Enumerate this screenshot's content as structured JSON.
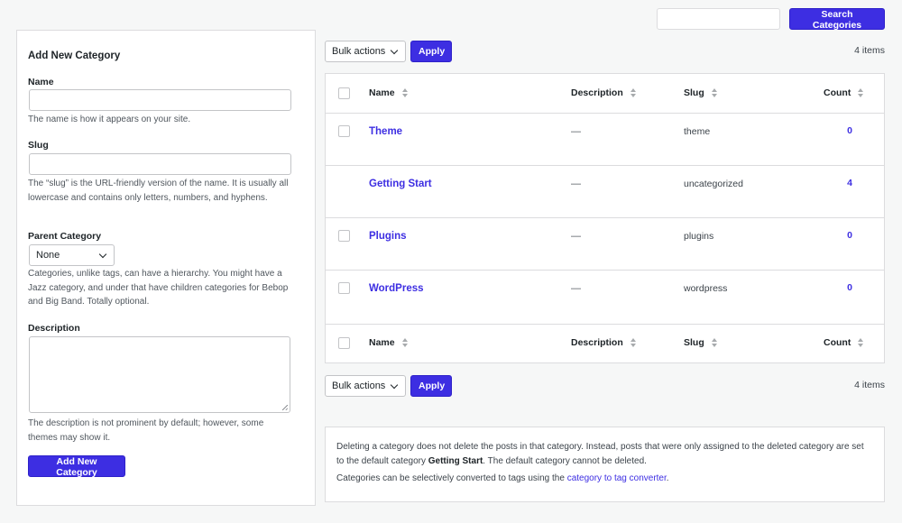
{
  "search": {
    "placeholder": "",
    "button_label": "Search Categories"
  },
  "form": {
    "title": "Add New Category",
    "name_label": "Name",
    "name_help": "The name is how it appears on your site.",
    "slug_label": "Slug",
    "slug_help": "The “slug” is the URL-friendly version of the name. It is usually all lowercase and contains only letters, numbers, and hyphens.",
    "parent_label": "Parent Category",
    "parent_value": "None",
    "parent_help": "Categories, unlike tags, can have a hierarchy. You might have a Jazz category, and under that have children categories for Bebop and Big Band. Totally optional.",
    "description_label": "Description",
    "description_help": "The description is not prominent by default; however, some themes may show it.",
    "submit_label": "Add New Category"
  },
  "bulk": {
    "label": "Bulk actions",
    "apply_label": "Apply",
    "items_count": "4 items"
  },
  "table": {
    "columns": {
      "name": "Name",
      "description": "Description",
      "slug": "Slug",
      "count": "Count"
    },
    "rows": [
      {
        "name": "Theme",
        "description": "—",
        "slug": "theme",
        "count": "0"
      },
      {
        "name": "Getting Start",
        "description": "—",
        "slug": "uncategorized",
        "count": "4"
      },
      {
        "name": "Plugins",
        "description": "—",
        "slug": "plugins",
        "count": "0"
      },
      {
        "name": "WordPress",
        "description": "—",
        "slug": "wordpress",
        "count": "0"
      }
    ]
  },
  "note": {
    "p1_a": "Deleting a category does not delete the posts in that category. Instead, posts that were only assigned to the deleted category are set to the default category ",
    "p1_bold": "Getting Start",
    "p1_b": ". The default category cannot be deleted.",
    "p2_a": "Categories can be selectively converted to tags using the ",
    "p2_link": "category to tag converter",
    "p2_b": "."
  },
  "colors": {
    "accent": "#3d2ee2",
    "border": "#dcdcde",
    "background": "#f6f7f7"
  }
}
